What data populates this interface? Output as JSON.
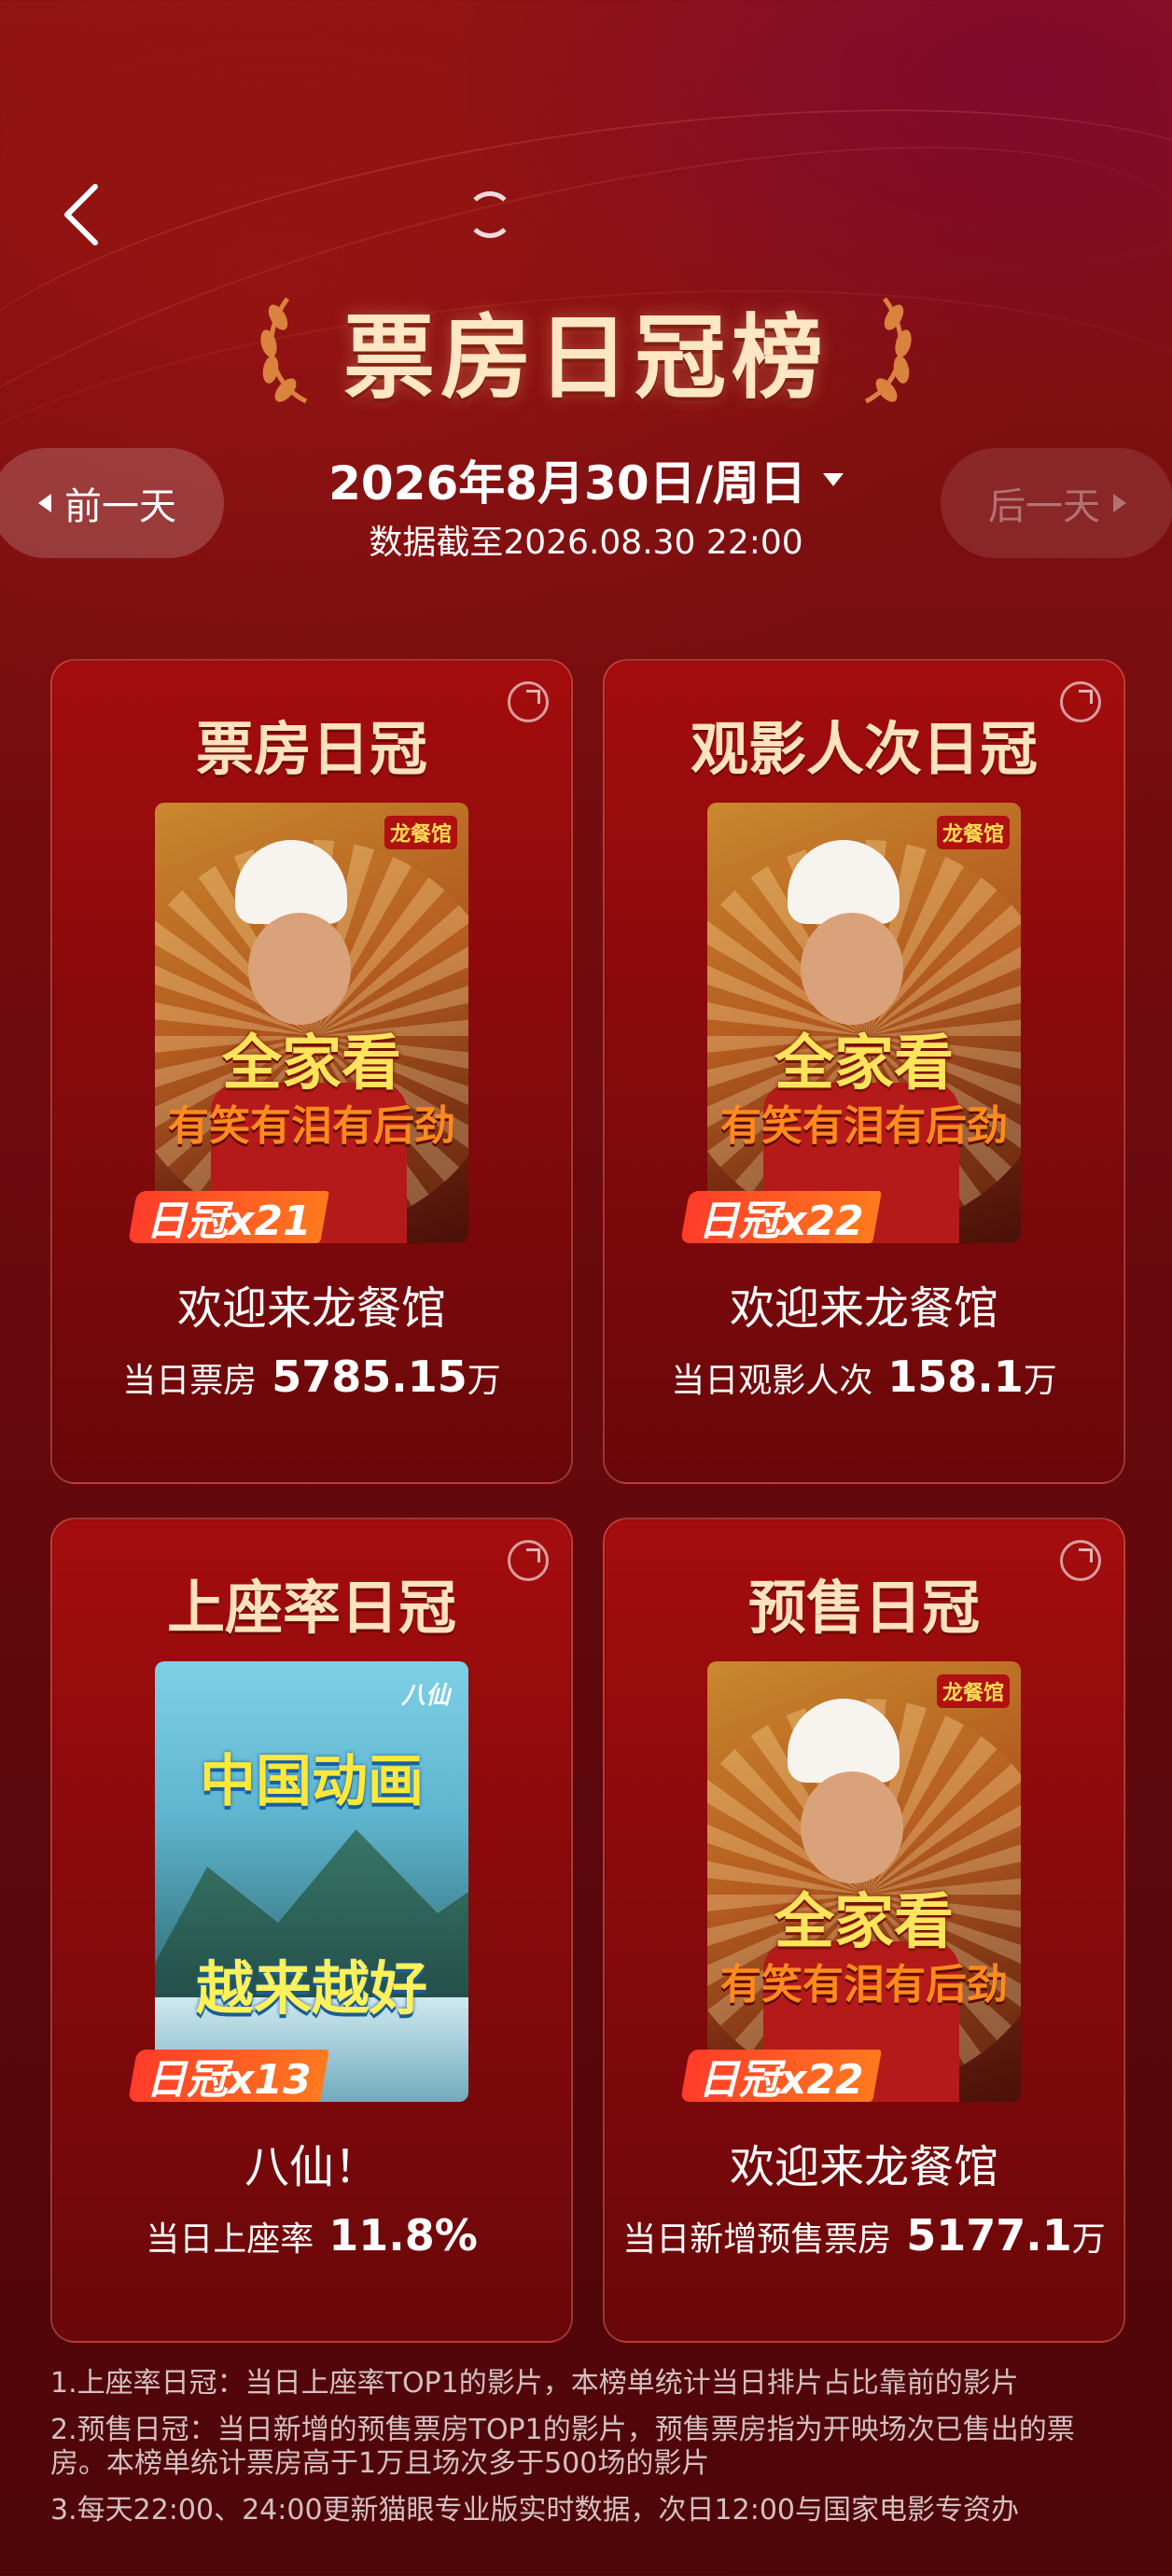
{
  "header": {
    "back_icon": "chevron-left-icon",
    "title": "票房日冠榜"
  },
  "date_nav": {
    "prev_label": "前一天",
    "next_label": "后一天",
    "date": "2026年8月30日/周日",
    "cutoff": "数据截至2026.08.30  22:00"
  },
  "cards": [
    {
      "title": "票房日冠",
      "poster": {
        "tag1": "全家看",
        "tag2": "有笑有泪有后劲",
        "brand": "龙餐馆"
      },
      "badge": "日冠x21",
      "movie": "欢迎来龙餐馆",
      "metric_label": "当日票房",
      "metric_value": "5785.15",
      "metric_unit": "万"
    },
    {
      "title": "观影人次日冠",
      "poster": {
        "tag1": "全家看",
        "tag2": "有笑有泪有后劲",
        "brand": "龙餐馆"
      },
      "badge": "日冠x22",
      "movie": "欢迎来龙餐馆",
      "metric_label": "当日观影人次",
      "metric_value": "158.1",
      "metric_unit": "万"
    },
    {
      "title": "上座率日冠",
      "poster": {
        "top": "中国动画",
        "bottom": "越来越好",
        "logo": "八仙"
      },
      "badge": "日冠x13",
      "movie": "八仙！",
      "metric_label": "当日上座率",
      "metric_value": "11.8%",
      "metric_unit": ""
    },
    {
      "title": "预售日冠",
      "poster": {
        "tag1": "全家看",
        "tag2": "有笑有泪有后劲",
        "brand": "龙餐馆"
      },
      "badge": "日冠x22",
      "movie": "欢迎来龙餐馆",
      "metric_label": "当日新增预售票房",
      "metric_value": "5177.1",
      "metric_unit": "万"
    }
  ],
  "notes": [
    "1.上座率日冠：当日上座率TOP1的影片，本榜单统计当日排片占比靠前的影片",
    "2.预售日冠：当日新增的预售票房TOP1的影片，预售票房指为开映场次已售出的票房。本榜单统计票房高于1万且场次多于500场的影片",
    "3.每天22:00、24:00更新猫眼专业版实时数据，次日12:00与国家电影专资办"
  ],
  "colors": {
    "background": "#6e0b0e",
    "card": "#8a0a0c",
    "title_gold": "#ffe2be",
    "badge": "#ff5a24"
  }
}
